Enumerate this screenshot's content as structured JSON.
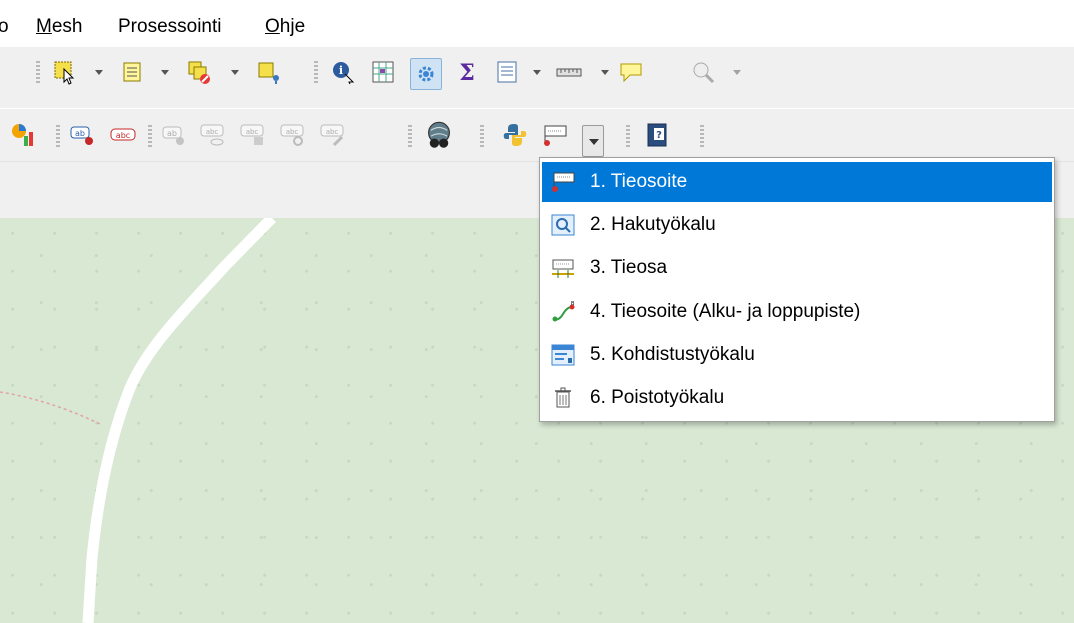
{
  "menubar": {
    "items": [
      {
        "label": "o"
      },
      {
        "label": "Mesh",
        "mnemonic": "M"
      },
      {
        "label": "Prosessointi"
      },
      {
        "label": "Ohje",
        "mnemonic": "O"
      }
    ]
  },
  "toolbar1": {
    "icons": [
      "select-features-icon",
      "select-by-attribute-icon",
      "deselect-icon",
      "select-location-icon",
      "identify-icon",
      "open-table-icon",
      "action-icon",
      "statistics-icon",
      "attribute-table-icon",
      "measure-icon",
      "map-tips-icon",
      "zoom-settings-icon"
    ]
  },
  "toolbar2": {
    "icons": [
      "diagram-icon",
      "label-pin-icon",
      "label-abc-icon",
      "label-move-icon",
      "label-show-icon",
      "label-rotate-icon",
      "label-change-icon",
      "label-edit-icon",
      "globe-binoculars-icon",
      "python-icon",
      "tieosoite-plugin-icon",
      "help-book-icon"
    ]
  },
  "dropdown": {
    "items": [
      {
        "label": "1. Tieosoite",
        "icon": "tieosoite-icon",
        "selected": true
      },
      {
        "label": "2. Hakutyökalu",
        "icon": "search-tool-icon",
        "selected": false
      },
      {
        "label": "3. Tieosa",
        "icon": "road-section-icon",
        "selected": false
      },
      {
        "label": "4. Tieosoite (Alku- ja loppupiste)",
        "icon": "start-end-point-icon",
        "selected": false
      },
      {
        "label": "5. Kohdistustyökalu",
        "icon": "targeting-tool-icon",
        "selected": false
      },
      {
        "label": "6. Poistotyökalu",
        "icon": "trash-icon",
        "selected": false
      }
    ]
  },
  "colors": {
    "selection": "#0078d7",
    "map_background": "#d8e8d3",
    "road": "#ffffff"
  }
}
